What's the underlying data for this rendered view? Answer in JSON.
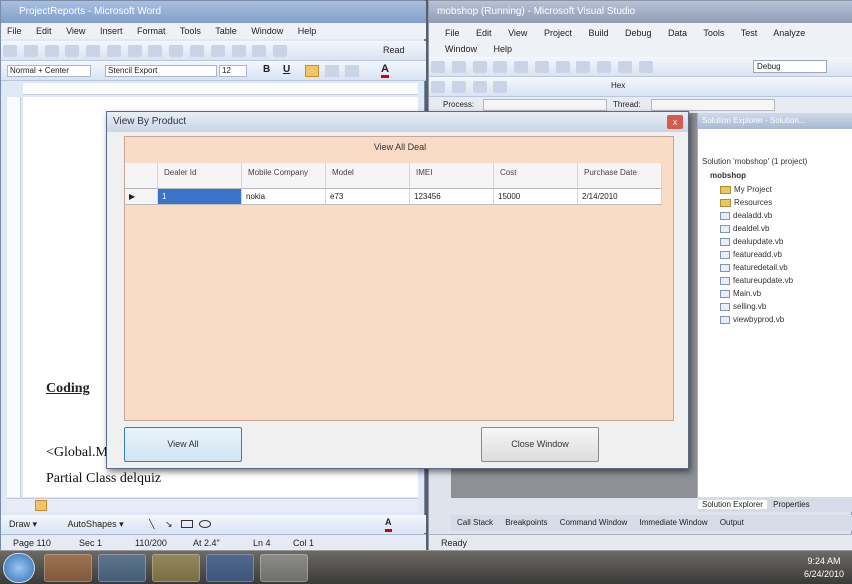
{
  "word": {
    "title": "ProjectReports - Microsoft Word",
    "menu": [
      "File",
      "Edit",
      "View",
      "Insert",
      "Format",
      "Tools",
      "Table",
      "Window",
      "Help"
    ],
    "read_label": "Read",
    "style_value": "Normal + Center",
    "font_value": "Stencil Export",
    "size_value": "12",
    "doc_heading": "Coding",
    "doc_line1": "<Global.M",
    "doc_line2": "Partial Class delquiz",
    "draw_label": "Draw ▾",
    "autoshapes_label": "AutoShapes ▾",
    "status": {
      "page": "Page 110",
      "sec": "Sec 1",
      "pages": "110/200",
      "at": "At 2.4\"",
      "ln": "Ln 4",
      "col": "Col 1"
    }
  },
  "vs": {
    "title": "mobshop (Running) - Microsoft Visual Studio",
    "menu_row1": [
      "File",
      "Edit",
      "View",
      "Project",
      "Build",
      "Debug",
      "Data",
      "Tools",
      "Test",
      "Analyze"
    ],
    "menu_row2": [
      "Window",
      "Help"
    ],
    "config_value": "Debug",
    "hex_label": "Hex",
    "process_label": "Process:",
    "thread_label": "Thread:",
    "solution_explorer_header": "Solution Explorer - Solution...",
    "solution_label": "Solution 'mobshop' (1 project)",
    "project_label": "mobshop",
    "items": [
      {
        "name": "My Project",
        "type": "folder"
      },
      {
        "name": "Resources",
        "type": "folder"
      },
      {
        "name": "dealadd.vb",
        "type": "file"
      },
      {
        "name": "dealdel.vb",
        "type": "file"
      },
      {
        "name": "dealupdate.vb",
        "type": "file"
      },
      {
        "name": "featureadd.vb",
        "type": "file"
      },
      {
        "name": "featuredetail.vb",
        "type": "file"
      },
      {
        "name": "featureupdate.vb",
        "type": "file"
      },
      {
        "name": "Main.vb",
        "type": "file"
      },
      {
        "name": "selling.vb",
        "type": "file"
      },
      {
        "name": "viewbyprod.vb",
        "type": "file"
      }
    ],
    "bottom_tabs": [
      "Solution Explorer",
      "Properties"
    ],
    "tool_tabs": [
      "Call Stack",
      "Breakpoints",
      "Command Window",
      "Immediate Window",
      "Output"
    ],
    "status": "Ready"
  },
  "dialog": {
    "title": "View By Product",
    "close_glyph": "x",
    "group_title": "View All Deal",
    "columns": [
      "Dealer Id",
      "Mobile Company",
      "Model",
      "IMEI",
      "Cost",
      "Purchase Date"
    ],
    "row": [
      "1",
      "nokia",
      "e73",
      "123456",
      "15000",
      "2/14/2010"
    ],
    "row_indicator": "▶",
    "view_all_label": "View All",
    "close_window_label": "Close Window"
  },
  "taskbar": {
    "time": "9:24 AM",
    "date": "6/24/2010"
  }
}
